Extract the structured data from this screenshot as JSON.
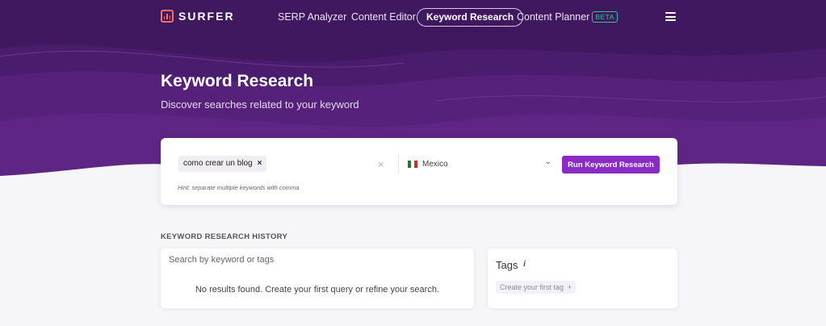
{
  "nav": {
    "logo_text": "SURFER",
    "items": [
      {
        "label": "SERP Analyzer"
      },
      {
        "label": "Content Editor"
      },
      {
        "label": "Keyword Research"
      },
      {
        "label": "Content Planner",
        "badge": "BETA"
      }
    ],
    "active": "Keyword Research",
    "menu_icon": "hamburger-menu-icon"
  },
  "hero": {
    "title": "Keyword Research",
    "subtitle": "Discover searches related to your keyword"
  },
  "search": {
    "keyword_chip": "como crear un blog",
    "chip_remove": "×",
    "clear": "×",
    "country": "Mexico",
    "country_chevron": "⌄",
    "run_button": "Run Keyword Research",
    "hint": "Hint: separate multiple keywords with comma"
  },
  "history": {
    "section_title": "KEYWORD RESEARCH HISTORY",
    "search_placeholder": "Search by keyword or tags",
    "empty_message": "No results found. Create your first query or refine your search."
  },
  "tags": {
    "title": "Tags",
    "info": "i",
    "create_label": "Create your first tag",
    "create_plus": "+"
  },
  "colors": {
    "hero_bg": "#3f1860",
    "accent_button": "#8a2bc5",
    "logo": "#ff6f61",
    "beta_badge": "#32c28e"
  }
}
